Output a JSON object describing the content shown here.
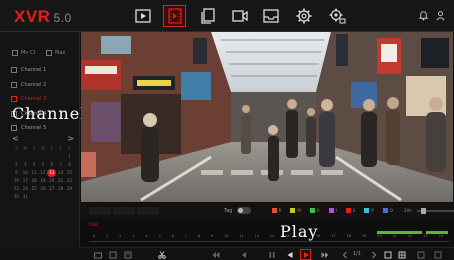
{
  "app": {
    "logo": "XVR",
    "version": "5.0"
  },
  "nav": {
    "items": [
      {
        "name": "live-view",
        "icon": "play-square-icon"
      },
      {
        "name": "playback",
        "icon": "film-icon",
        "active": true
      },
      {
        "name": "files",
        "icon": "files-icon"
      },
      {
        "name": "camera",
        "icon": "camera-icon"
      },
      {
        "name": "backup",
        "icon": "inbox-icon"
      },
      {
        "name": "settings",
        "icon": "gear-icon"
      },
      {
        "name": "system",
        "icon": "gear-network-icon"
      }
    ],
    "right_icons": [
      "bell-icon",
      "user-icon"
    ]
  },
  "left": {
    "main_label": "Mn Ct",
    "aux_label": "Max",
    "channels": [
      {
        "label": "Channel 1"
      },
      {
        "label": "Channel 2"
      },
      {
        "label": "Channel 3",
        "selected": true
      },
      {
        "label": "Channel 4"
      },
      {
        "label": "Channel 5"
      }
    ],
    "calendar": {
      "prev": "<",
      "next": ">",
      "weekdays": [
        "S",
        "M",
        "T",
        "W",
        "T",
        "F",
        "S"
      ],
      "rows": [
        [
          "",
          "",
          "",
          "",
          "",
          "",
          "1"
        ],
        [
          "2",
          "3",
          "4",
          "5",
          "6",
          "7",
          "8"
        ],
        [
          "9",
          "10",
          "11",
          "12",
          "13",
          "14",
          "15"
        ],
        [
          "16",
          "17",
          "18",
          "19",
          "20",
          "21",
          "22"
        ],
        [
          "23",
          "24",
          "25",
          "26",
          "27",
          "28",
          "29"
        ],
        [
          "30",
          "31",
          "",
          "",
          "",
          "",
          ""
        ]
      ],
      "today": "13"
    }
  },
  "overlays": {
    "channel": "Channel",
    "play": "Play"
  },
  "controls": {
    "tag_label": "Tag",
    "legend": [
      {
        "label": "R",
        "color": "#e0532a"
      },
      {
        "label": "M",
        "color": "#c8c81e"
      },
      {
        "label": "A",
        "color": "#3fbf3a"
      },
      {
        "label": "I",
        "color": "#b84ad6"
      },
      {
        "label": "S",
        "color": "#e21d1d"
      },
      {
        "label": "P",
        "color": "#3ac2d6"
      },
      {
        "label": "O",
        "color": "#4a70e0"
      }
    ],
    "zoom_label": "24h"
  },
  "timeline": {
    "channel_tag": "CH3",
    "hours": [
      "0",
      "1",
      "2",
      "3",
      "4",
      "5",
      "6",
      "7",
      "8",
      "9",
      "10",
      "11",
      "12",
      "13",
      "14",
      "15",
      "16",
      "17",
      "18",
      "19",
      "20",
      "21",
      "22",
      "23",
      "24"
    ],
    "recording_color": "#4fbf2e"
  },
  "playback": {
    "page": "1/1"
  }
}
